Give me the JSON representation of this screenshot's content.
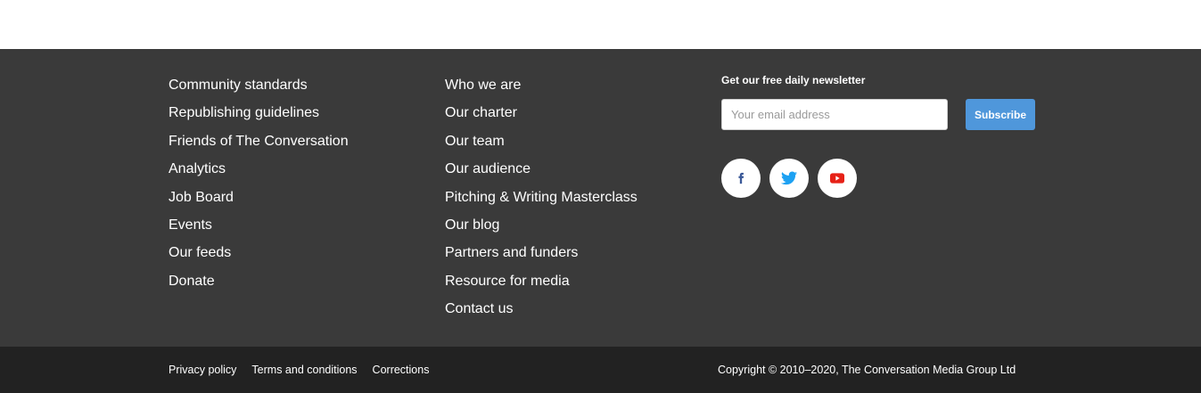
{
  "footer": {
    "column_one": [
      "Community standards",
      "Republishing guidelines",
      "Friends of The Conversation",
      "Analytics",
      "Job Board",
      "Events",
      "Our feeds",
      "Donate"
    ],
    "column_two": [
      "Who we are",
      "Our charter",
      "Our team",
      "Our audience",
      "Pitching & Writing Masterclass",
      "Our blog",
      "Partners and funders",
      "Resource for media",
      "Contact us"
    ],
    "newsletter": {
      "title": "Get our free daily newsletter",
      "email_placeholder": "Your email address",
      "subscribe_label": "Subscribe"
    },
    "social": [
      {
        "name": "facebook-icon",
        "color": "#3b5998"
      },
      {
        "name": "twitter-icon",
        "color": "#1da1f2"
      },
      {
        "name": "youtube-icon",
        "color": "#e62117"
      }
    ],
    "legal_links": [
      "Privacy policy",
      "Terms and conditions",
      "Corrections"
    ],
    "copyright": "Copyright © 2010–2020, The Conversation Media Group Ltd"
  },
  "colors": {
    "footer_bg": "#3a3a3a",
    "bottom_bar_bg": "#222222",
    "accent": "#4f97db"
  }
}
